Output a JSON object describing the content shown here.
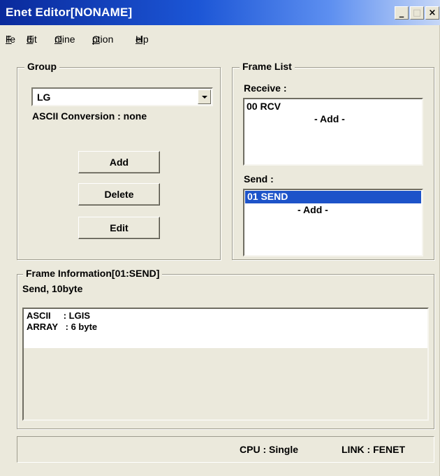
{
  "window": {
    "title": "Enet Editor[NONAME]",
    "minimize_glyph": "_",
    "maximize_glyph": "□",
    "close_glyph": "×"
  },
  "menu": {
    "items": [
      {
        "mnemonic": "F",
        "rest": "ile"
      },
      {
        "mnemonic": "E",
        "rest": "dit"
      },
      {
        "mnemonic": "O",
        "rest": "nline"
      },
      {
        "mnemonic": "O",
        "rest": "ption"
      },
      {
        "mnemonic": "H",
        "rest": "elp"
      }
    ]
  },
  "group": {
    "legend": "Group",
    "selected": "LG",
    "ascii_conversion": "ASCII Conversion : none",
    "add_label": "Add",
    "delete_label": "Delete",
    "edit_label": "Edit"
  },
  "frame_list": {
    "legend": "Frame List",
    "receive_label": "Receive :",
    "receive_items": [
      "00 RCV",
      "- Add -"
    ],
    "send_label": "Send :",
    "send_items": [
      "01 SEND",
      "- Add -"
    ]
  },
  "frame_info": {
    "legend": "Frame Information[01:SEND]",
    "summary": "Send, 10byte",
    "lines": [
      "ASCII     : LGIS",
      "ARRAY   : 6 byte"
    ]
  },
  "status": {
    "cpu": "CPU : Single",
    "link": "LINK : FENET"
  }
}
